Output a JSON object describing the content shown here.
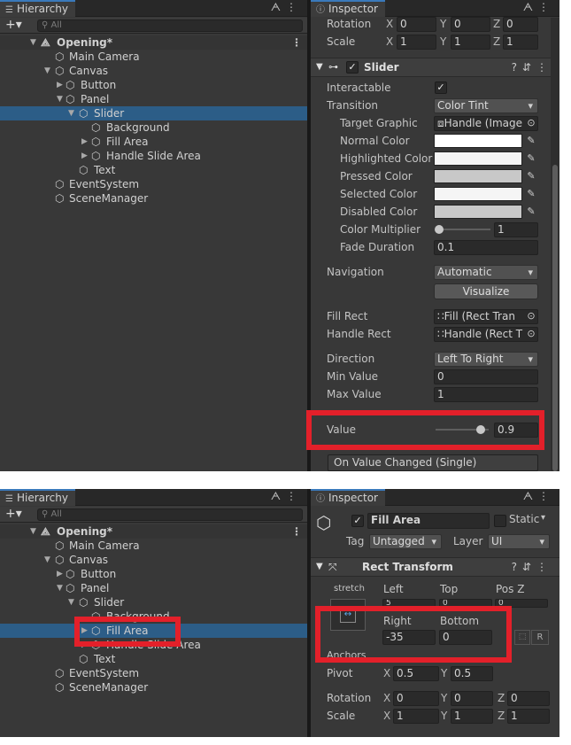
{
  "screen1": {
    "hierarchy": {
      "tab_label": "Hierarchy",
      "add_label": "+▾",
      "search_placeholder": "All",
      "scene_name": "Opening*",
      "items": [
        {
          "label": "Main Camera"
        },
        {
          "label": "Canvas"
        },
        {
          "label": "Button"
        },
        {
          "label": "Panel"
        },
        {
          "label": "Slider"
        },
        {
          "label": "Background"
        },
        {
          "label": "Fill Area"
        },
        {
          "label": "Handle Slide Area"
        },
        {
          "label": "Text"
        },
        {
          "label": "EventSystem"
        },
        {
          "label": "SceneManager"
        }
      ]
    },
    "inspector": {
      "tab_label": "Inspector",
      "rotation": {
        "label": "Rotation",
        "x": "0",
        "y": "0",
        "z": "0"
      },
      "scale": {
        "label": "Scale",
        "x": "1",
        "y": "1",
        "z": "1"
      },
      "component_title": "Slider",
      "interactable_label": "Interactable",
      "transition": {
        "label": "Transition",
        "value": "Color Tint"
      },
      "target_graphic": {
        "label": "Target Graphic",
        "value": "Handle (Image"
      },
      "normal_color": {
        "label": "Normal Color",
        "color": "#ffffff"
      },
      "highlighted_color": {
        "label": "Highlighted Color",
        "color": "#f5f5f5"
      },
      "pressed_color": {
        "label": "Pressed Color",
        "color": "#c8c8c8"
      },
      "selected_color": {
        "label": "Selected Color",
        "color": "#f5f5f5"
      },
      "disabled_color": {
        "label": "Disabled Color",
        "color": "#c8c8c8"
      },
      "color_multiplier": {
        "label": "Color Multiplier",
        "value": "1"
      },
      "fade_duration": {
        "label": "Fade Duration",
        "value": "0.1"
      },
      "navigation": {
        "label": "Navigation",
        "value": "Automatic"
      },
      "visualize_label": "Visualize",
      "fill_rect": {
        "label": "Fill Rect",
        "value": "Fill (Rect Tran"
      },
      "handle_rect": {
        "label": "Handle Rect",
        "value": "Handle (Rect T"
      },
      "direction": {
        "label": "Direction",
        "value": "Left To Right"
      },
      "min_value": {
        "label": "Min Value",
        "value": "0"
      },
      "max_value": {
        "label": "Max Value",
        "value": "1"
      },
      "value": {
        "label": "Value",
        "value": "0.9"
      },
      "on_value_changed": "On Value Changed (Single)"
    }
  },
  "screen2": {
    "hierarchy": {
      "tab_label": "Hierarchy",
      "add_label": "+▾",
      "search_placeholder": "All",
      "scene_name": "Opening*",
      "items": [
        {
          "label": "Main Camera"
        },
        {
          "label": "Canvas"
        },
        {
          "label": "Button"
        },
        {
          "label": "Panel"
        },
        {
          "label": "Slider"
        },
        {
          "label": "Background"
        },
        {
          "label": "Fill Area"
        },
        {
          "label": "Handle Slide Area"
        },
        {
          "label": "Text"
        },
        {
          "label": "EventSystem"
        },
        {
          "label": "SceneManager"
        }
      ]
    },
    "inspector": {
      "tab_label": "Inspector",
      "object_name": "Fill Area",
      "static_label": "Static",
      "tag": {
        "label": "Tag",
        "value": "Untagged"
      },
      "layer": {
        "label": "Layer",
        "value": "UI"
      },
      "component_title": "Rect Transform",
      "stretch_label": "stretch",
      "left": {
        "label": "Left",
        "value": "5"
      },
      "top": {
        "label": "Top",
        "value": "0"
      },
      "posz": {
        "label": "Pos Z",
        "value": "0"
      },
      "right": {
        "label": "Right",
        "value": "-35"
      },
      "bottom": {
        "label": "Bottom",
        "value": "0"
      },
      "r_button": "R",
      "anchors_label": "Anchors",
      "pivot": {
        "label": "Pivot",
        "x": "0.5",
        "y": "0.5"
      },
      "rotation": {
        "label": "Rotation",
        "x": "0",
        "y": "0",
        "z": "0"
      },
      "scale": {
        "label": "Scale",
        "x": "1",
        "y": "1",
        "z": "1"
      }
    }
  },
  "colors": {
    "selection": "#2c5d87",
    "highlight_box": "#e3202a",
    "panel_bg": "#383838"
  }
}
